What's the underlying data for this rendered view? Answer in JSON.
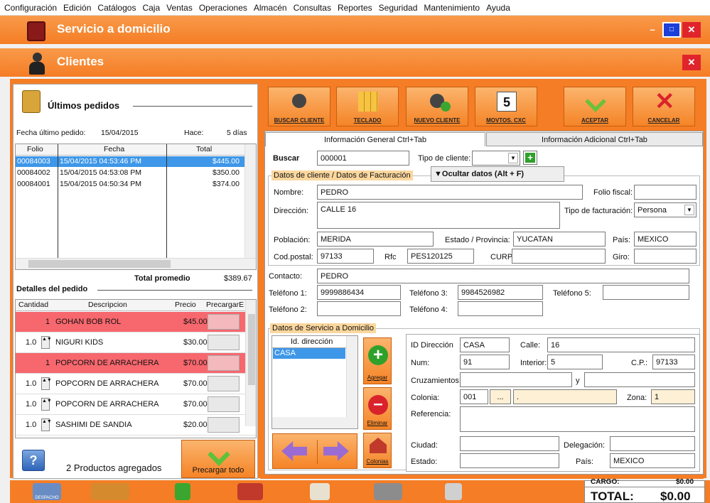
{
  "menu": [
    "Configuración",
    "Edición",
    "Catálogos",
    "Caja",
    "Ventas",
    "Operaciones",
    "Almacén",
    "Consultas",
    "Reportes",
    "Seguridad",
    "Mantenimiento",
    "Ayuda"
  ],
  "window1": {
    "title": "Servicio a domicilio",
    "minimize": "–",
    "maximize": "□",
    "close": "✕"
  },
  "window2": {
    "title": "Clientes",
    "close": "✕"
  },
  "left": {
    "title": "Últimos pedidos",
    "last_order_label": "Fecha último pedido:",
    "last_order_value": "15/04/2015",
    "ago_label": "Hace:",
    "ago_value": "5 días",
    "orders_headers": [
      "Folio",
      "Fecha",
      "Total"
    ],
    "orders": [
      {
        "folio": "00084003",
        "fecha": "15/04/2015 04:53:46 PM",
        "total": "$445.00"
      },
      {
        "folio": "00084002",
        "fecha": "15/04/2015 04:53:08 PM",
        "total": "$350.00"
      },
      {
        "folio": "00084001",
        "fecha": "15/04/2015 04:50:34 PM",
        "total": "$374.00"
      }
    ],
    "avg_label": "Total promedio",
    "avg_value": "$389.67",
    "details_title": "Detalles del pedido",
    "details_headers": [
      "Cantidad",
      "Descripcion",
      "Precio",
      "PrecargarE"
    ],
    "details": [
      {
        "qty": "1",
        "desc": "GOHAN BOB ROL",
        "price": "$45.00",
        "red": true,
        "spin": false
      },
      {
        "qty": "1.0",
        "desc": "NIGURI KIDS",
        "price": "$30.00",
        "red": false,
        "spin": true
      },
      {
        "qty": "1",
        "desc": "POPCORN DE ARRACHERA",
        "price": "$70.00",
        "red": true,
        "spin": false
      },
      {
        "qty": "1.0",
        "desc": "POPCORN DE ARRACHERA",
        "price": "$70.00",
        "red": false,
        "spin": true
      },
      {
        "qty": "1.0",
        "desc": "POPCORN DE ARRACHERA",
        "price": "$70.00",
        "red": false,
        "spin": true
      },
      {
        "qty": "1.0",
        "desc": "SASHIMI DE SANDIA",
        "price": "$20.00",
        "red": false,
        "spin": true
      }
    ],
    "products_added": "2 Productos agregados",
    "preload_all": "Precargar todo"
  },
  "toolbar": {
    "buscar": "BUSCAR CLIENTE",
    "teclado": "TECLADO",
    "nuevo": "NUEVO CLIENTE",
    "movtos": "MOVTOS. CXC",
    "calendar_num": "5",
    "aceptar": "ACEPTAR",
    "cancelar": "CANCELAR"
  },
  "tabs": {
    "general": "Información General  Ctrl+Tab",
    "adicional": "Información Adicional  Ctrl+Tab"
  },
  "form": {
    "buscar_label": "Buscar",
    "buscar_value": "000001",
    "tipo_cliente_label": "Tipo de cliente:",
    "datos_cliente": "Datos de cliente / Datos de Facturación",
    "ocultar": "Ocultar datos (Alt + F)",
    "nombre_label": "Nombre:",
    "nombre_value": "PEDRO",
    "folio_fiscal_label": "Folio fiscal:",
    "direccion_label": "Dirección:",
    "direccion_value": "CALLE 16",
    "tipo_fact_label": "Tipo de facturación:",
    "tipo_fact_value": "Persona",
    "poblacion_label": "Población:",
    "poblacion_value": "MERIDA",
    "estado_label": "Estado / Provincia:",
    "estado_value": "YUCATAN",
    "pais_label": "País:",
    "pais_value": "MEXICO",
    "cp_label": "Cod.postal:",
    "cp_value": "97133",
    "rfc_label": "Rfc",
    "rfc_value": "PES120125",
    "curp_label": "CURP",
    "giro_label": "Giro:",
    "contacto_label": "Contacto:",
    "contacto_value": "PEDRO",
    "tel1_label": "Teléfono 1:",
    "tel1_value": "9999886434",
    "tel3_label": "Teléfono 3:",
    "tel3_value": "9984526982",
    "tel5_label": "Teléfono 5:",
    "tel2_label": "Teléfono 2:",
    "tel4_label": "Teléfono 4:"
  },
  "service": {
    "title": "Datos de Servicio a Domicilio",
    "list_header": "Id. dirección",
    "list_items": [
      "CASA"
    ],
    "agregar": "Agregar",
    "eliminar": "Eliminar",
    "colonias": "Colonias",
    "id_dir_label": "ID Dirección",
    "id_dir_value": "CASA",
    "calle_label": "Calle:",
    "calle_value": "16",
    "num_label": "Num:",
    "num_value": "91",
    "interior_label": "Interior:",
    "interior_value": "5",
    "cp_label": "C.P.:",
    "cp_value": "97133",
    "cruz_label": "Cruzamientos:",
    "y_label": "y",
    "colonia_label": "Colonia:",
    "colonia_value": "001",
    "colonia_btn": "...",
    "colonia_name": ".",
    "zona_label": "Zona:",
    "zona_value": "1",
    "referencia_label": "Referencia:",
    "ciudad_label": "Ciudad:",
    "delegacion_label": "Delegación:",
    "estado_label": "Estado:",
    "pais_label": "País:",
    "pais_value": "MEXICO"
  },
  "bottom": {
    "despacho": "DESPACHO",
    "cargo": "CARGO:",
    "cargo_value": "$0.00",
    "total_label": "TOTAL:",
    "total_value": "$0.00"
  }
}
